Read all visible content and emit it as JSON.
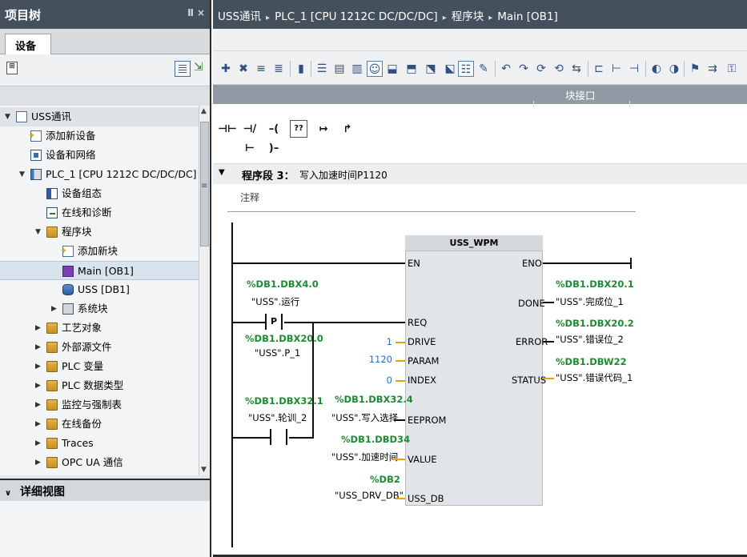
{
  "left_panel": {
    "title": "项目树",
    "pin_icon": "Ⅱ",
    "close_icon": "×",
    "tab_label": "设备",
    "tree": [
      {
        "label": "USS通讯",
        "indent": 0,
        "arrow": "▼",
        "icon": "doc"
      },
      {
        "label": "添加新设备",
        "indent": 1,
        "arrow": "",
        "icon": "star"
      },
      {
        "label": "设备和网络",
        "indent": 1,
        "arrow": "",
        "icon": "net"
      },
      {
        "label": "PLC_1 [CPU 1212C DC/DC/DC]",
        "indent": 1,
        "arrow": "▼",
        "icon": "plc"
      },
      {
        "label": "设备组态",
        "indent": 2,
        "arrow": "",
        "icon": "cfg"
      },
      {
        "label": "在线和诊断",
        "indent": 2,
        "arrow": "",
        "icon": "diag"
      },
      {
        "label": "程序块",
        "indent": 2,
        "arrow": "▼",
        "icon": "folder"
      },
      {
        "label": "添加新块",
        "indent": 3,
        "arrow": "",
        "icon": "star"
      },
      {
        "label": "Main [OB1]",
        "indent": 3,
        "arrow": "",
        "icon": "ob",
        "selected": true
      },
      {
        "label": "USS [DB1]",
        "indent": 3,
        "arrow": "",
        "icon": "db"
      },
      {
        "label": "系统块",
        "indent": 3,
        "arrow": "▶",
        "icon": "sys"
      },
      {
        "label": "工艺对象",
        "indent": 2,
        "arrow": "▶",
        "icon": "folder"
      },
      {
        "label": "外部源文件",
        "indent": 2,
        "arrow": "▶",
        "icon": "folder"
      },
      {
        "label": "PLC 变量",
        "indent": 2,
        "arrow": "▶",
        "icon": "folder"
      },
      {
        "label": "PLC 数据类型",
        "indent": 2,
        "arrow": "▶",
        "icon": "folder"
      },
      {
        "label": "监控与强制表",
        "indent": 2,
        "arrow": "▶",
        "icon": "folder"
      },
      {
        "label": "在线备份",
        "indent": 2,
        "arrow": "▶",
        "icon": "folder"
      },
      {
        "label": "Traces",
        "indent": 2,
        "arrow": "▶",
        "icon": "folder"
      },
      {
        "label": "OPC UA 通信",
        "indent": 2,
        "arrow": "▶",
        "icon": "folder"
      }
    ],
    "detail_view_label": "详细视图",
    "detail_chevron": "∨"
  },
  "breadcrumb": [
    "USS通讯",
    "PLC_1 [CPU 1212C DC/DC/DC]",
    "程序块",
    "Main [OB1]"
  ],
  "breadcrumb_sep": "▸",
  "interface_bar_label": "块接口",
  "favorites": [
    "⊣⊢",
    "⊣/⊢",
    "–( )–",
    "??",
    "↦",
    "↱"
  ],
  "network": {
    "chevron": "▼",
    "title": "程序段 3：",
    "name": "写入加速时间P1120",
    "comment": "注释"
  },
  "block": {
    "name": "USS_WPM",
    "inputs": [
      "EN",
      "REQ",
      "DRIVE",
      "PARAM",
      "INDEX",
      "EEPROM",
      "VALUE",
      "USS_DB"
    ],
    "outputs": [
      "ENO",
      "DONE",
      "ERROR",
      "STATUS"
    ],
    "input_consts": {
      "DRIVE": "1",
      "PARAM": "1120",
      "INDEX": "0"
    },
    "operands": {
      "EEPROM": {
        "addr": "%DB1.DBX32.4",
        "sym": "\"USS\".写入选择"
      },
      "VALUE": {
        "addr": "%DB1.DBD34",
        "sym": "\"USS\".加速时间"
      },
      "USS_DB": {
        "addr": "%DB2",
        "sym": "\"USS_DRV_DB\""
      },
      "DONE": {
        "addr": "%DB1.DBX20.1",
        "sym": "\"USS\".完成位_1"
      },
      "ERROR": {
        "addr": "%DB1.DBX20.2",
        "sym": "\"USS\".错误位_2"
      },
      "STATUS": {
        "addr": "%DB1.DBW22",
        "sym": "\"USS\".错误代码_1"
      }
    }
  },
  "contacts": [
    {
      "addr": "%DB1.DBX4.0",
      "sym": "\"USS\".运行",
      "label": "P"
    },
    {
      "addr": "%DB1.DBX20.0",
      "sym": "\"USS\".P_1"
    },
    {
      "addr": "%DB1.DBX32.1",
      "sym": "\"USS\".轮训_2"
    }
  ],
  "colors": {
    "title_bar": "#44505c",
    "address_green": "#1f8a33",
    "const_blue": "#2f6fb0",
    "wire_orange": "#e8a300",
    "selection": "#d9e3ee"
  }
}
